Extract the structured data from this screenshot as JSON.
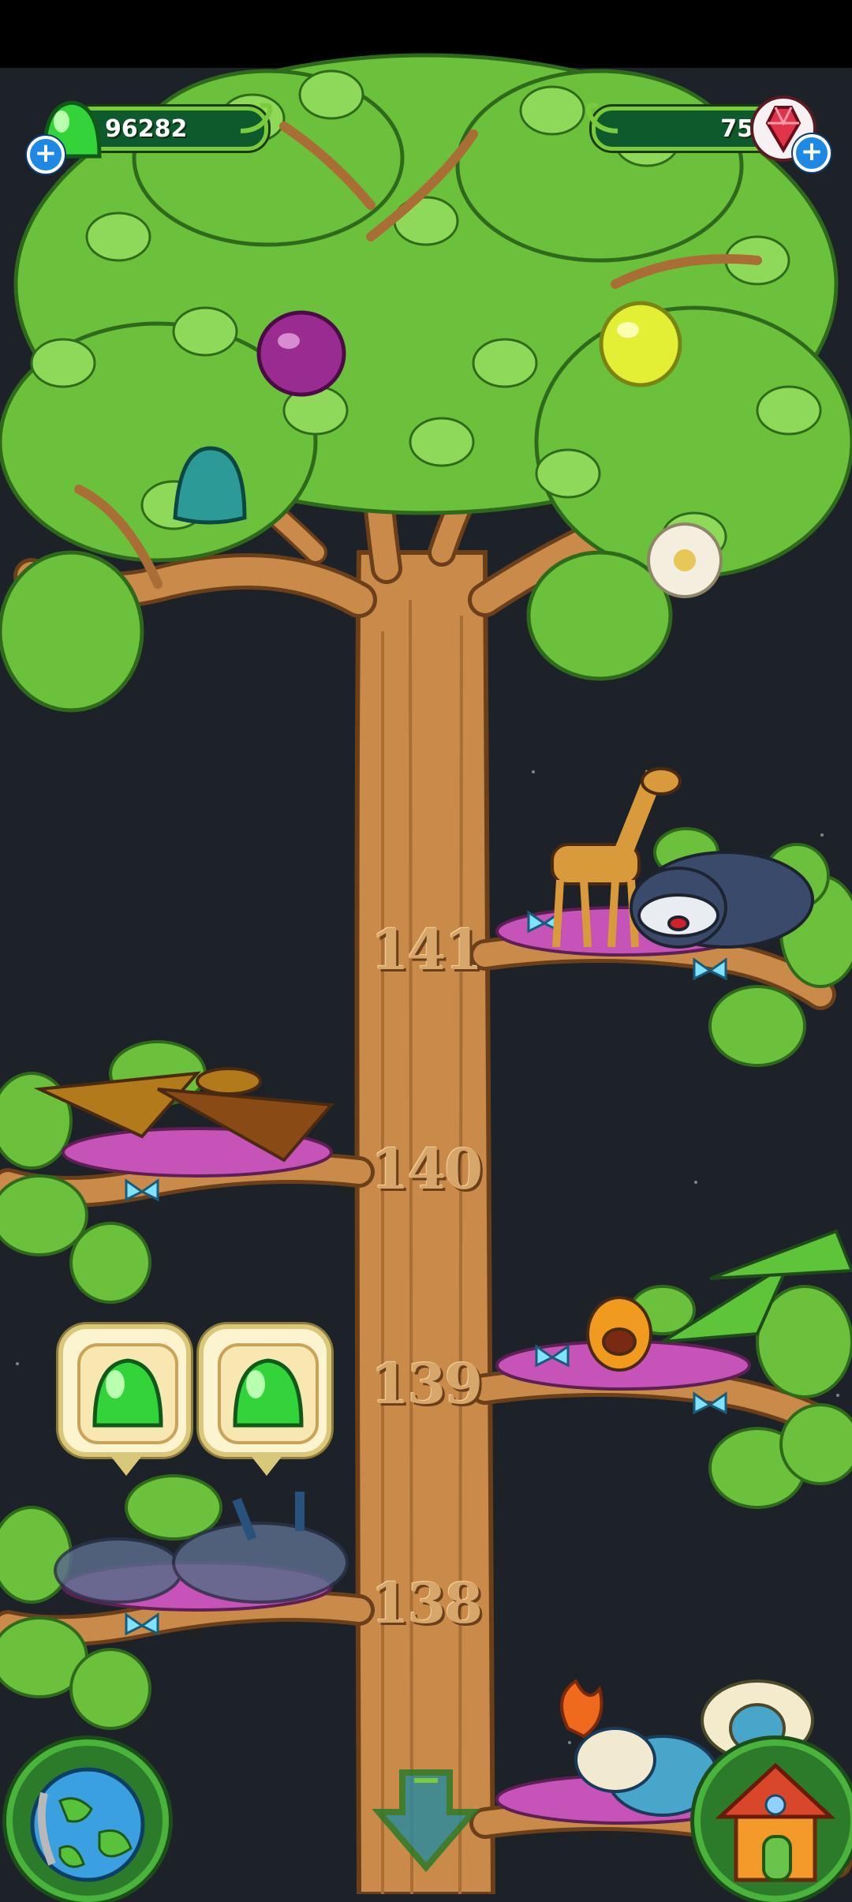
{
  "hud": {
    "jelly_count": "96282",
    "gem_count": "75",
    "jelly_plus": "+",
    "gem_plus": "+"
  },
  "tree": {
    "levels": [
      "141",
      "140",
      "139",
      "138"
    ]
  },
  "colors": {
    "sky": "#1d2128",
    "leaf": "#6cc13c",
    "trunk": "#c98a4a",
    "hud_pill": "#0f5a2c",
    "jelly_green": "#33d43a"
  },
  "icons": {
    "jelly": "green-jelly-icon",
    "gem": "red-gem-icon",
    "globe": "globe-icon",
    "house": "house-icon",
    "scroll_down": "down-arrow-icon"
  }
}
